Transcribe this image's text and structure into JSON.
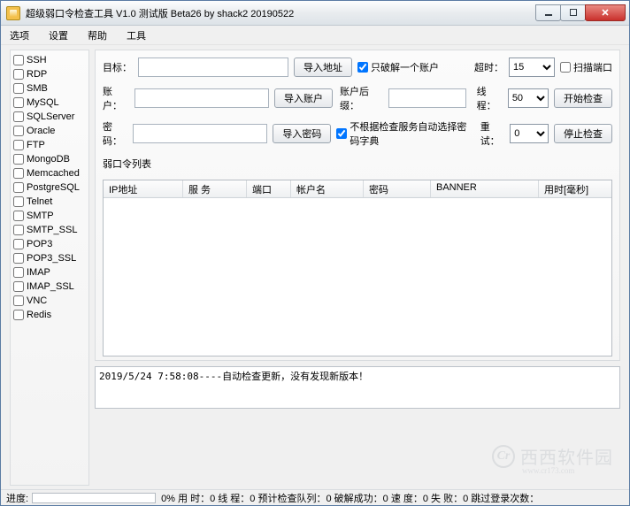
{
  "window": {
    "title": "超级弱口令检查工具 V1.0 测试版 Beta26 by shack2 20190522"
  },
  "menu": {
    "items": [
      "选项",
      "设置",
      "帮助",
      "工具"
    ]
  },
  "services": [
    {
      "name": "SSH",
      "checked": false
    },
    {
      "name": "RDP",
      "checked": false
    },
    {
      "name": "SMB",
      "checked": false
    },
    {
      "name": "MySQL",
      "checked": false
    },
    {
      "name": "SQLServer",
      "checked": false
    },
    {
      "name": "Oracle",
      "checked": false
    },
    {
      "name": "FTP",
      "checked": false
    },
    {
      "name": "MongoDB",
      "checked": false
    },
    {
      "name": "Memcached",
      "checked": false
    },
    {
      "name": "PostgreSQL",
      "checked": false
    },
    {
      "name": "Telnet",
      "checked": false
    },
    {
      "name": "SMTP",
      "checked": false
    },
    {
      "name": "SMTP_SSL",
      "checked": false
    },
    {
      "name": "POP3",
      "checked": false
    },
    {
      "name": "POP3_SSL",
      "checked": false
    },
    {
      "name": "IMAP",
      "checked": false
    },
    {
      "name": "IMAP_SSL",
      "checked": false
    },
    {
      "name": "VNC",
      "checked": false
    },
    {
      "name": "Redis",
      "checked": false
    }
  ],
  "config": {
    "labels": {
      "target": "目标：",
      "account": "账户：",
      "password": "密码：",
      "suffix": "账户后缀：",
      "timeout": "超时：",
      "threads": "线程：",
      "retry": "重试："
    },
    "buttons": {
      "import_target": "导入地址",
      "import_user": "导入账户",
      "import_pass": "导入密码",
      "start": "开始检查",
      "stop": "停止检查"
    },
    "checkboxes": {
      "single_account": {
        "label": "只破解一个账户",
        "checked": true
      },
      "scan_port": {
        "label": "扫描端口",
        "checked": false
      },
      "auto_dict": {
        "label": "不根据检查服务自动选择密码字典",
        "checked": true
      }
    },
    "values": {
      "target": "",
      "account": "",
      "password": "",
      "suffix": "",
      "timeout": "15",
      "threads": "50",
      "retry": "0"
    }
  },
  "results": {
    "caption": "弱口令列表",
    "columns": [
      "IP地址",
      "服 务",
      "端口",
      "帐户名",
      "密码",
      "BANNER",
      "用时[毫秒]"
    ],
    "widths": [
      90,
      72,
      50,
      82,
      76,
      122,
      74
    ],
    "rows": []
  },
  "log": {
    "text": "2019/5/24 7:58:08----自动检查更新，没有发现新版本！"
  },
  "status": {
    "progress_label": "进度:",
    "segments": [
      "0% 用 时：0 线 程：0 预计检查队列：0 破解成功：0 速 度：0 失 败：0 跳过登录次数："
    ]
  },
  "watermark": {
    "logo_letters": "Cr",
    "text": "西西软件园",
    "sub": "www.cr173.com"
  }
}
